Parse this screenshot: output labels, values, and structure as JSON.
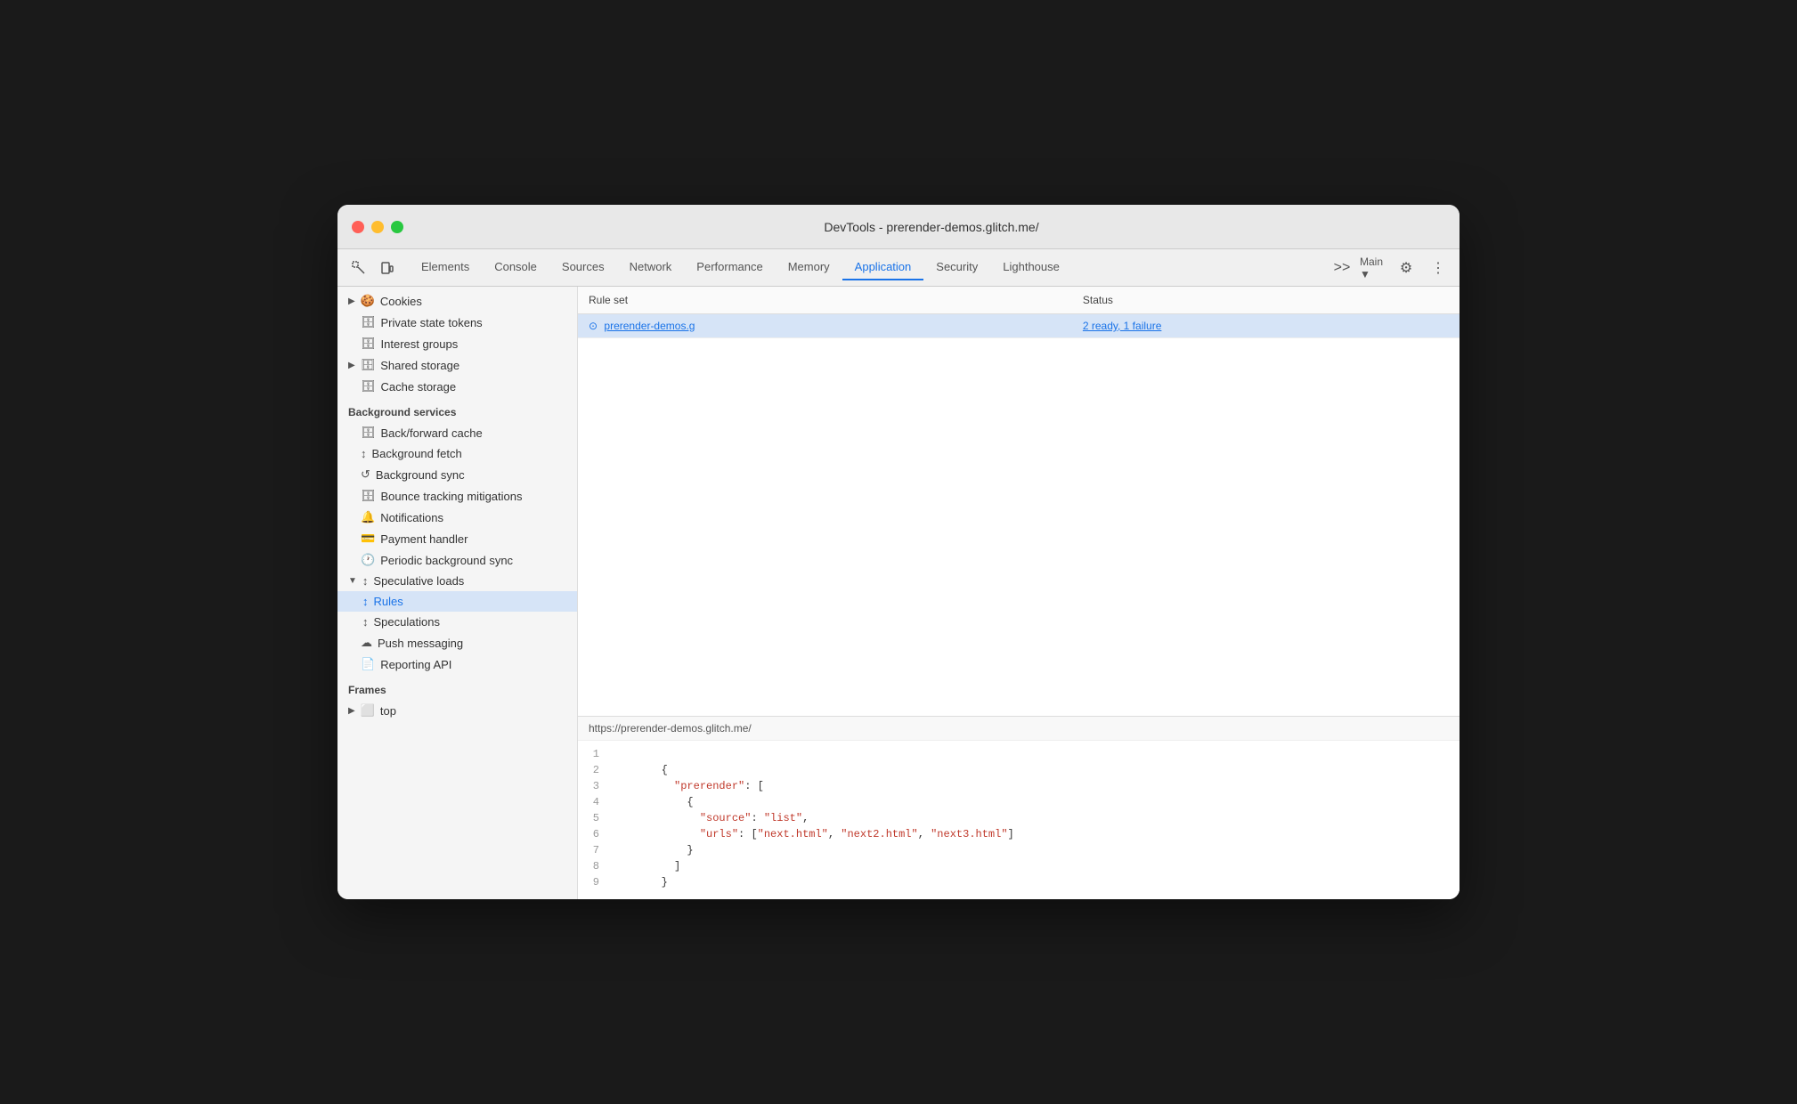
{
  "window": {
    "title": "DevTools - prerender-demos.glitch.me/"
  },
  "toolbar": {
    "tabs": [
      {
        "label": "Elements",
        "active": false
      },
      {
        "label": "Console",
        "active": false
      },
      {
        "label": "Sources",
        "active": false
      },
      {
        "label": "Network",
        "active": false
      },
      {
        "label": "Performance",
        "active": false
      },
      {
        "label": "Memory",
        "active": false
      },
      {
        "label": "Application",
        "active": true
      },
      {
        "label": "Security",
        "active": false
      },
      {
        "label": "Lighthouse",
        "active": false
      }
    ],
    "more_tabs": ">>",
    "context": "Main",
    "chevron": "▼"
  },
  "sidebar": {
    "storage_items": [
      {
        "label": "Cookies",
        "icon": "▶",
        "has_arrow": true,
        "indent": 0
      },
      {
        "label": "Private state tokens",
        "icon": "🗄",
        "indent": 0
      },
      {
        "label": "Interest groups",
        "icon": "🗄",
        "indent": 0
      },
      {
        "label": "Shared storage",
        "icon": "▶",
        "has_arrow": true,
        "indent": 0
      },
      {
        "label": "Cache storage",
        "icon": "🗄",
        "indent": 0
      }
    ],
    "bg_section": "Background services",
    "bg_items": [
      {
        "label": "Back/forward cache",
        "icon": "🗄"
      },
      {
        "label": "Background fetch",
        "icon": "↕"
      },
      {
        "label": "Background sync",
        "icon": "↺"
      },
      {
        "label": "Bounce tracking mitigations",
        "icon": "🗄"
      },
      {
        "label": "Notifications",
        "icon": "🔔"
      },
      {
        "label": "Payment handler",
        "icon": "💳"
      },
      {
        "label": "Periodic background sync",
        "icon": "🕐"
      },
      {
        "label": "Speculative loads",
        "icon": "↕",
        "expanded": true
      },
      {
        "label": "Rules",
        "icon": "↕",
        "indent": 2
      },
      {
        "label": "Speculations",
        "icon": "↕",
        "indent": 2
      },
      {
        "label": "Push messaging",
        "icon": "☁"
      },
      {
        "label": "Reporting API",
        "icon": "📄"
      }
    ],
    "frames_section": "Frames",
    "frames_items": [
      {
        "label": "top",
        "icon": "▶",
        "has_arrow": true
      }
    ]
  },
  "table": {
    "col_ruleset": "Rule set",
    "col_status": "Status",
    "rows": [
      {
        "ruleset": "prerender-demos.g",
        "status": "2 ready, 1 failure",
        "selected": true
      }
    ]
  },
  "code_panel": {
    "url": "https://prerender-demos.glitch.me/",
    "lines": [
      {
        "num": 1,
        "content": ""
      },
      {
        "num": 2,
        "content": "        {"
      },
      {
        "num": 3,
        "content": "          \"prerender\": ["
      },
      {
        "num": 4,
        "content": "            {"
      },
      {
        "num": 5,
        "content": "              \"source\": \"list\","
      },
      {
        "num": 6,
        "content": "              \"urls\": [\"next.html\", \"next2.html\", \"next3.html\"]"
      },
      {
        "num": 7,
        "content": "            }"
      },
      {
        "num": 8,
        "content": "          ]"
      },
      {
        "num": 9,
        "content": "        }"
      }
    ]
  }
}
